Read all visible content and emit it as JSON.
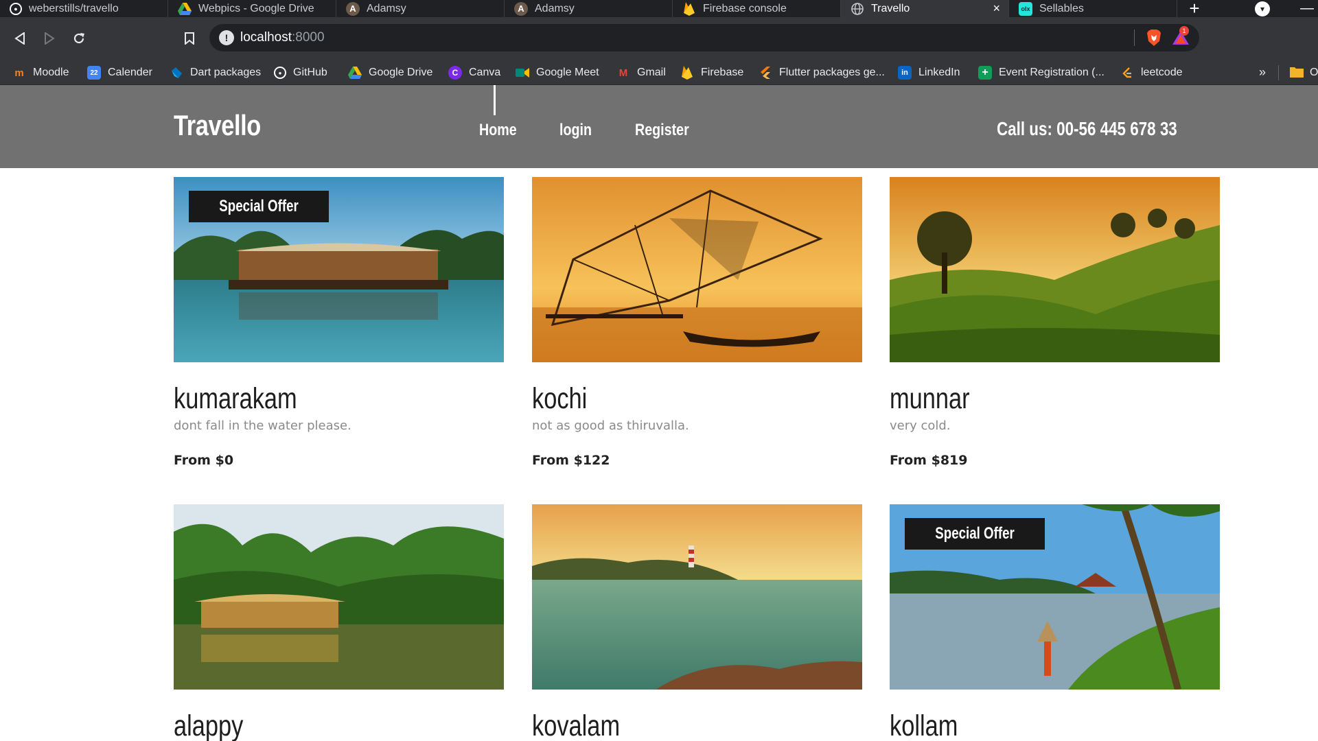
{
  "browser": {
    "tabs": [
      {
        "title": "weberstills/travello",
        "icon": "github-icon"
      },
      {
        "title": "Webpics - Google Drive",
        "icon": "google-drive-icon"
      },
      {
        "title": "Adamsy",
        "icon": "adamsy-icon"
      },
      {
        "title": "Adamsy",
        "icon": "adamsy-icon"
      },
      {
        "title": "Firebase console",
        "icon": "firebase-icon"
      },
      {
        "title": "Travello",
        "icon": "globe-icon",
        "active": true
      },
      {
        "title": "Sellables",
        "icon": "olx-icon"
      }
    ],
    "new_tab": "+",
    "close_tab": "×",
    "url_host": "localhost",
    "url_port": ":8000",
    "rewards_count": "1",
    "bookmarks": [
      {
        "label": "Moodle",
        "icon": "moodle-icon",
        "color": "#f98012"
      },
      {
        "label": "Calender",
        "icon": "calendar-icon",
        "color": "#4285f4",
        "glyph": "22"
      },
      {
        "label": "Dart packages",
        "icon": "dart-icon",
        "color": "#0175c2"
      },
      {
        "label": "GitHub",
        "icon": "github-icon",
        "color": "#ffffff"
      },
      {
        "label": "Google Drive",
        "icon": "google-drive-icon",
        "color": "#34a853"
      },
      {
        "label": "Canva",
        "icon": "canva-icon",
        "color": "#00c4cc",
        "glyph": "C"
      },
      {
        "label": "Google Meet",
        "icon": "google-meet-icon",
        "color": "#00897b"
      },
      {
        "label": "Gmail",
        "icon": "gmail-icon",
        "color": "#ea4335",
        "glyph": "M"
      },
      {
        "label": "Firebase",
        "icon": "firebase-icon",
        "color": "#ffca28"
      },
      {
        "label": "Flutter packages ge...",
        "icon": "flutter-icon",
        "color": "#f57c00"
      },
      {
        "label": "LinkedIn",
        "icon": "linkedin-icon",
        "color": "#0a66c2",
        "glyph": "in"
      },
      {
        "label": "Event Registration (...",
        "icon": "google-forms-icon",
        "color": "#0f9d58",
        "glyph": "+"
      },
      {
        "label": "leetcode",
        "icon": "leetcode-icon",
        "color": "#ffa116"
      }
    ],
    "bookmarks_more": "»",
    "bookmarks_folder_label": "O"
  },
  "site": {
    "logo": "Travello",
    "nav": [
      {
        "label": "Home",
        "active": true
      },
      {
        "label": "login"
      },
      {
        "label": "Register"
      }
    ],
    "call": "Call us: 00-56 445 678 33"
  },
  "badge_text": "Special Offer",
  "destinations": [
    {
      "name": "kumarakam",
      "desc": "dont fall in the water please.",
      "price": "From $0",
      "special": true,
      "scene": "houseboat-lake"
    },
    {
      "name": "kochi",
      "desc": "not as good as thiruvalla.",
      "price": "From $122",
      "special": false,
      "scene": "fishing-nets-sunset"
    },
    {
      "name": "munnar",
      "desc": "very cold.",
      "price": "From $819",
      "special": false,
      "scene": "tea-hills-sunset"
    },
    {
      "name": "alappy",
      "desc": "",
      "price": "",
      "special": false,
      "scene": "houseboat-palms"
    },
    {
      "name": "kovalam",
      "desc": "",
      "price": "",
      "special": false,
      "scene": "lighthouse-beach"
    },
    {
      "name": "kollam",
      "desc": "",
      "price": "",
      "special": true,
      "scene": "backwater-palm"
    }
  ],
  "colors": {
    "header_bg": "#717171",
    "badge_bg": "#191919",
    "chrome_dark": "#202124",
    "chrome_bar": "#35363a"
  }
}
